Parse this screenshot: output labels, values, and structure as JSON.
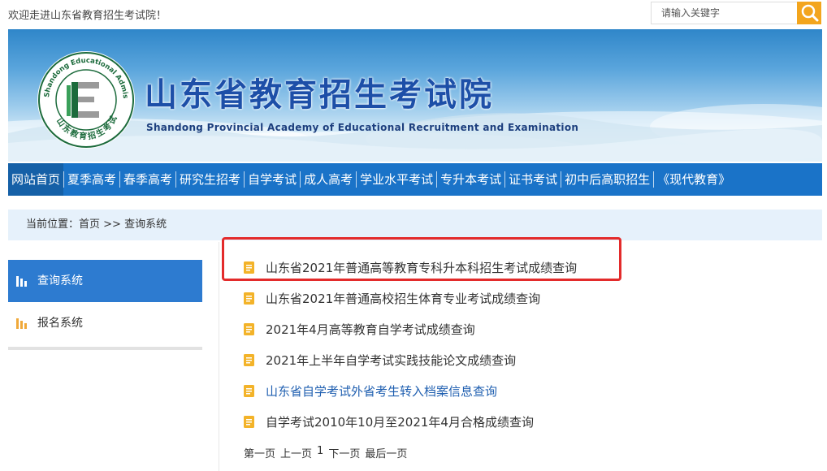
{
  "top": {
    "welcome": "欢迎走进山东省教育招生考试院！",
    "search_placeholder": "请输入关键字"
  },
  "banner": {
    "title": "山东省教育招生考试院",
    "subtitle": "Shandong Provincial Academy of Educational Recruitment and Examination",
    "logo_ring_text_en": "Shandong Educational Admission & Examinations",
    "logo_ring_text_cn": "山东教育招生考试"
  },
  "nav": {
    "items": [
      {
        "label": "网站首页"
      },
      {
        "label": "夏季高考"
      },
      {
        "label": "春季高考"
      },
      {
        "label": "研究生招考"
      },
      {
        "label": "自学考试"
      },
      {
        "label": "成人高考"
      },
      {
        "label": "学业水平考试"
      },
      {
        "label": "专升本考试"
      },
      {
        "label": "证书考试"
      },
      {
        "label": "初中后高职招生"
      },
      {
        "label": "《现代教育》"
      }
    ]
  },
  "breadcrumb": {
    "prefix": "当前位置：",
    "home": "首页",
    "sep": " >> ",
    "current": "查询系统"
  },
  "sidebar": {
    "items": [
      {
        "label": "查询系统",
        "icon": "bar-chart-icon"
      },
      {
        "label": "报名系统",
        "icon": "bar-chart-icon"
      }
    ]
  },
  "list": {
    "items": [
      {
        "title": "山东省2021年普通高等教育专科升本科招生考试成绩查询"
      },
      {
        "title": "山东省2021年普通高校招生体育专业考试成绩查询"
      },
      {
        "title": "2021年4月高等教育自学考试成绩查询"
      },
      {
        "title": "2021年上半年自学考试实践技能论文成绩查询"
      },
      {
        "title": "山东省自学考试外省考生转入档案信息查询"
      },
      {
        "title": "自学考试2010年10月至2021年4月合格成绩查询"
      }
    ]
  },
  "pager": {
    "first": "第一页",
    "prev": "上一页",
    "page": "1",
    "next": "下一页",
    "last": "最后一页"
  },
  "colors": {
    "nav_bg": "#1a73c8",
    "search_btn": "#f3a51d",
    "highlight": "#e32b2b",
    "link_blue": "#1f5fb0"
  }
}
